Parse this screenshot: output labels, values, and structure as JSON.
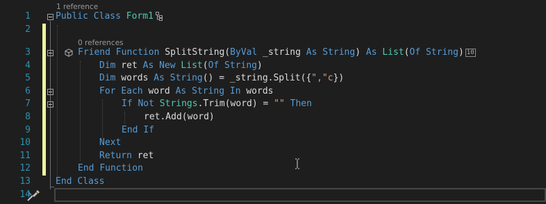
{
  "line_numbers": [
    "1",
    "2",
    "3",
    "4",
    "5",
    "6",
    "7",
    "8",
    "9",
    "10",
    "11",
    "12",
    "13",
    "14"
  ],
  "codelens": {
    "class_refs": "1 reference",
    "function_refs": "0 references"
  },
  "code": {
    "l1": {
      "kw1": "Public",
      "kw2": "Class",
      "name": "Form1"
    },
    "l3": {
      "kw1": "Friend",
      "kw2": "Function",
      "name": "SplitString(",
      "kw3": "ByVal",
      "param": " _string ",
      "kw4": "As",
      "ty1": "String",
      "p2": ") ",
      "kw5": "As",
      "ty2": "List",
      "p3": "(",
      "kw6": "Of",
      "ty3": "String",
      "p4": ")",
      "badge": "10"
    },
    "l4": {
      "kw1": "Dim",
      "p1": " ret ",
      "kw2": "As",
      "kw3": "New",
      "ty1": "List",
      "p2": "(",
      "kw4": "Of",
      "ty2": "String",
      "p3": ")"
    },
    "l5": {
      "kw1": "Dim",
      "p1": " words ",
      "kw2": "As",
      "ty1": "String",
      "p2": "() = _string.Split({",
      "s1": "\",\"c",
      "p3": "})"
    },
    "l6": {
      "kw1": "For",
      "kw2": "Each",
      "p1": " word ",
      "kw3": "As",
      "ty1": "String",
      "kw4": "In",
      "p2": " words"
    },
    "l7": {
      "kw1": "If",
      "kw2": "Not",
      "ty1": "Strings",
      "p1": ".Trim(word) = ",
      "s1": "\"\"",
      "kw3": "Then"
    },
    "l8": {
      "p1": "ret.Add(word)"
    },
    "l9": {
      "kw1": "End",
      "kw2": "If"
    },
    "l10": {
      "kw1": "Next"
    },
    "l11": {
      "kw1": "Return",
      "p1": " ret"
    },
    "l12": {
      "kw1": "End",
      "kw2": "Function"
    },
    "l13": {
      "kw1": "End",
      "kw2": "Class"
    }
  },
  "icons": {
    "class_icon": "class-hierarchy-icon",
    "function_icon": "method-cube-icon",
    "quick_action_icon": "screwdriver-brush-icon",
    "cursor_icon": "ibeam-cursor-icon"
  },
  "colors": {
    "background": "#1e1e1e",
    "keyword": "#569cd6",
    "type": "#4ec9b0",
    "string": "#d69d85",
    "line_number": "#2b91af",
    "change_bar": "#eff59f"
  }
}
